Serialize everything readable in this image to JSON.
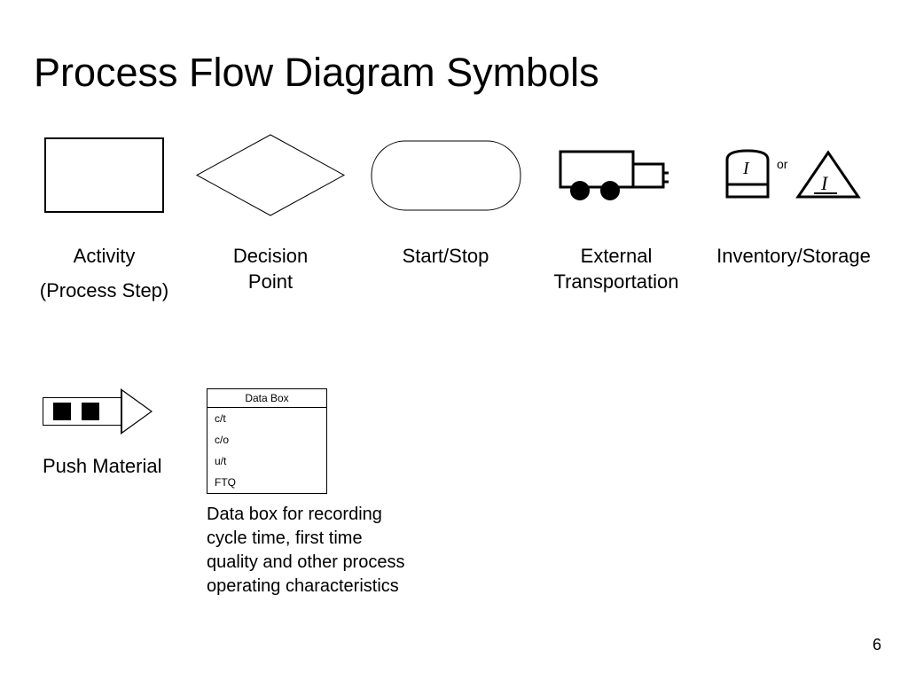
{
  "title": "Process Flow Diagram Symbols",
  "page_number": "6",
  "symbols": {
    "activity": {
      "label": "Activity",
      "sub": "(Process Step)"
    },
    "decision": {
      "label": "Decision Point"
    },
    "startstop": {
      "label": "Start/Stop"
    },
    "transport": {
      "label": "External Transportation"
    },
    "inventory": {
      "label": "Inventory/Storage",
      "or": "or",
      "letter": "I"
    }
  },
  "push": {
    "label": "Push Material"
  },
  "databox": {
    "header": "Data Box",
    "rows": [
      "c/t",
      "c/o",
      "u/t",
      "FTQ"
    ],
    "description": "Data box for recording cycle time, first time quality and other process operating characteristics"
  }
}
